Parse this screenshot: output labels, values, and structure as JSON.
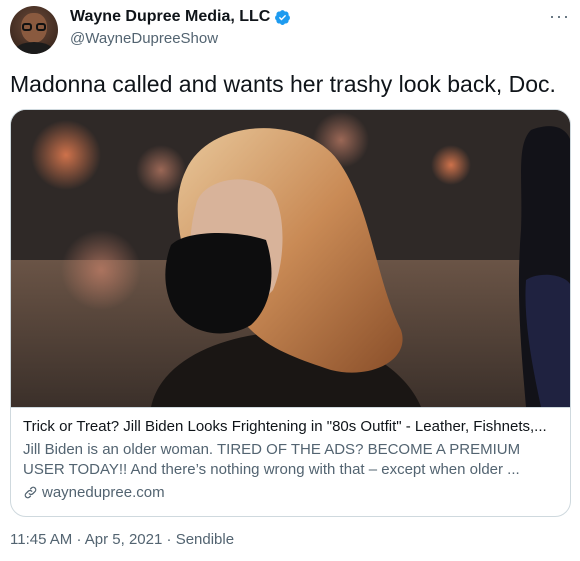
{
  "author": {
    "display_name": "Wayne Dupree Media, LLC",
    "handle": "@WayneDupreeShow",
    "verified_icon": "verified-badge-icon",
    "avatar_icon": "avatar-icon"
  },
  "menu": {
    "more_label": "···"
  },
  "tweet": {
    "text": "Madonna called and wants her trashy look back, Doc."
  },
  "card": {
    "image_icon": "article-photo",
    "title": "Trick or Treat? Jill Biden Looks Frightening in \"80s Outfit\" - Leather, Fishnets,...",
    "description": "Jill Biden is an older woman. TIRED OF THE ADS? BECOME A PREMIUM USER TODAY!! And there’s nothing wrong with that – except when older ...",
    "domain": "wayneduprее.com"
  },
  "meta": {
    "time": "11:45 AM",
    "separator": "·",
    "date": "Apr 5, 2021",
    "source": "Sendible"
  },
  "colors": {
    "text": "#0f1419",
    "secondary": "#536471",
    "verified": "#1d9bf0",
    "border": "#cfd9de"
  }
}
